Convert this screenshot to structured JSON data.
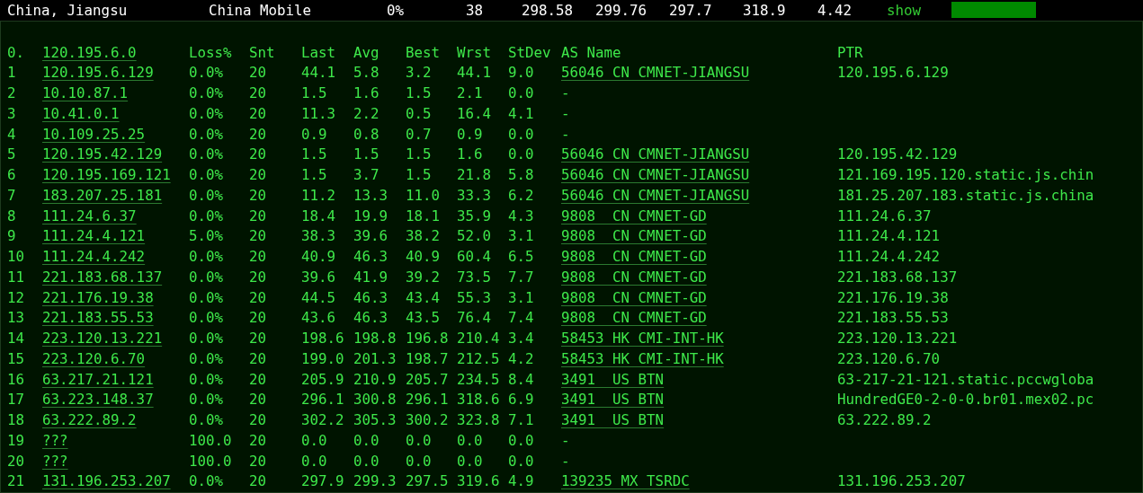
{
  "summary": {
    "location": "China, Jiangsu",
    "carrier": "China Mobile",
    "loss": "0%",
    "sent": "38",
    "last": "298.58",
    "avg": "299.76",
    "best": "297.7",
    "worst": "318.9",
    "stdev": "4.42",
    "toggle": "show"
  },
  "header": {
    "hop": "0.",
    "host": "120.195.6.0",
    "columns": [
      "Loss%",
      "Snt",
      "Last",
      "Avg",
      "Best",
      "Wrst",
      "StDev",
      "AS Name",
      "PTR"
    ]
  },
  "rows": [
    {
      "hop": "1",
      "host": "120.195.6.129",
      "loss": "0.0%",
      "snt": "20",
      "last": "44.1",
      "avg": "5.8",
      "best": "3.2",
      "wrst": "44.1",
      "stdev": "9.0",
      "as_name": "56046 CN CMNET-JIANGSU",
      "as_linked": true,
      "ptr": "120.195.6.129"
    },
    {
      "hop": "2",
      "host": "10.10.87.1",
      "loss": "0.0%",
      "snt": "20",
      "last": "1.5",
      "avg": "1.6",
      "best": "1.5",
      "wrst": "2.1",
      "stdev": "0.0",
      "as_name": "-",
      "as_linked": false
    },
    {
      "hop": "3",
      "host": "10.41.0.1",
      "loss": "0.0%",
      "snt": "20",
      "last": "11.3",
      "avg": "2.2",
      "best": "0.5",
      "wrst": "16.4",
      "stdev": "4.1",
      "as_name": "-",
      "as_linked": false
    },
    {
      "hop": "4",
      "host": "10.109.25.25",
      "loss": "0.0%",
      "snt": "20",
      "last": "0.9",
      "avg": "0.8",
      "best": "0.7",
      "wrst": "0.9",
      "stdev": "0.0",
      "as_name": "-",
      "as_linked": false
    },
    {
      "hop": "5",
      "host": "120.195.42.129",
      "loss": "0.0%",
      "snt": "20",
      "last": "1.5",
      "avg": "1.5",
      "best": "1.5",
      "wrst": "1.6",
      "stdev": "0.0",
      "as_name": "56046 CN CMNET-JIANGSU",
      "as_linked": true,
      "ptr": "120.195.42.129"
    },
    {
      "hop": "6",
      "host": "120.195.169.121",
      "loss": "0.0%",
      "snt": "20",
      "last": "1.5",
      "avg": "3.7",
      "best": "1.5",
      "wrst": "21.8",
      "stdev": "5.8",
      "as_name": "56046 CN CMNET-JIANGSU",
      "as_linked": true,
      "ptr": "121.169.195.120.static.js.chin"
    },
    {
      "hop": "7",
      "host": "183.207.25.181",
      "loss": "0.0%",
      "snt": "20",
      "last": "11.2",
      "avg": "13.3",
      "best": "11.0",
      "wrst": "33.3",
      "stdev": "6.2",
      "as_name": "56046 CN CMNET-JIANGSU",
      "as_linked": true,
      "ptr": "181.25.207.183.static.js.china"
    },
    {
      "hop": "8",
      "host": "111.24.6.37",
      "loss": "0.0%",
      "snt": "20",
      "last": "18.4",
      "avg": "19.9",
      "best": "18.1",
      "wrst": "35.9",
      "stdev": "4.3",
      "as_name": "9808  CN CMNET-GD",
      "as_linked": true,
      "ptr": "111.24.6.37"
    },
    {
      "hop": "9",
      "host": "111.24.4.121",
      "loss": "5.0%",
      "snt": "20",
      "last": "38.3",
      "avg": "39.6",
      "best": "38.2",
      "wrst": "52.0",
      "stdev": "3.1",
      "as_name": "9808  CN CMNET-GD",
      "as_linked": true,
      "ptr": "111.24.4.121"
    },
    {
      "hop": "10",
      "host": "111.24.4.242",
      "loss": "0.0%",
      "snt": "20",
      "last": "40.9",
      "avg": "46.3",
      "best": "40.9",
      "wrst": "60.4",
      "stdev": "6.5",
      "as_name": "9808  CN CMNET-GD",
      "as_linked": true,
      "ptr": "111.24.4.242"
    },
    {
      "hop": "11",
      "host": "221.183.68.137",
      "loss": "0.0%",
      "snt": "20",
      "last": "39.6",
      "avg": "41.9",
      "best": "39.2",
      "wrst": "73.5",
      "stdev": "7.7",
      "as_name": "9808  CN CMNET-GD",
      "as_linked": true,
      "ptr": "221.183.68.137"
    },
    {
      "hop": "12",
      "host": "221.176.19.38",
      "loss": "0.0%",
      "snt": "20",
      "last": "44.5",
      "avg": "46.3",
      "best": "43.4",
      "wrst": "55.3",
      "stdev": "3.1",
      "as_name": "9808  CN CMNET-GD",
      "as_linked": true,
      "ptr": "221.176.19.38"
    },
    {
      "hop": "13",
      "host": "221.183.55.53",
      "loss": "0.0%",
      "snt": "20",
      "last": "43.6",
      "avg": "46.3",
      "best": "43.5",
      "wrst": "76.4",
      "stdev": "7.4",
      "as_name": "9808  CN CMNET-GD",
      "as_linked": true,
      "ptr": "221.183.55.53"
    },
    {
      "hop": "14",
      "host": "223.120.13.221",
      "loss": "0.0%",
      "snt": "20",
      "last": "198.6",
      "avg": "198.8",
      "best": "196.8",
      "wrst": "210.4",
      "stdev": "3.4",
      "as_name": "58453 HK CMI-INT-HK",
      "as_linked": true,
      "ptr": "223.120.13.221"
    },
    {
      "hop": "15",
      "host": "223.120.6.70",
      "loss": "0.0%",
      "snt": "20",
      "last": "199.0",
      "avg": "201.3",
      "best": "198.7",
      "wrst": "212.5",
      "stdev": "4.2",
      "as_name": "58453 HK CMI-INT-HK",
      "as_linked": true,
      "ptr": "223.120.6.70"
    },
    {
      "hop": "16",
      "host": "63.217.21.121",
      "loss": "0.0%",
      "snt": "20",
      "last": "205.9",
      "avg": "210.9",
      "best": "205.7",
      "wrst": "234.5",
      "stdev": "8.4",
      "as_name": "3491  US BTN",
      "as_linked": true,
      "ptr": "63-217-21-121.static.pccwgloba"
    },
    {
      "hop": "17",
      "host": "63.223.148.37",
      "loss": "0.0%",
      "snt": "20",
      "last": "296.1",
      "avg": "300.8",
      "best": "296.1",
      "wrst": "318.6",
      "stdev": "6.9",
      "as_name": "3491  US BTN",
      "as_linked": true,
      "ptr": "HundredGE0-2-0-0.br01.mex02.pc"
    },
    {
      "hop": "18",
      "host": "63.222.89.2",
      "loss": "0.0%",
      "snt": "20",
      "last": "302.2",
      "avg": "305.3",
      "best": "300.2",
      "wrst": "323.8",
      "stdev": "7.1",
      "as_name": "3491  US BTN",
      "as_linked": true,
      "ptr": "63.222.89.2"
    },
    {
      "hop": "19",
      "host": "???",
      "loss": "100.0",
      "snt": "20",
      "last": "0.0",
      "avg": "0.0",
      "best": "0.0",
      "wrst": "0.0",
      "stdev": "0.0",
      "as_name": "-",
      "as_linked": false
    },
    {
      "hop": "20",
      "host": "???",
      "loss": "100.0",
      "snt": "20",
      "last": "0.0",
      "avg": "0.0",
      "best": "0.0",
      "wrst": "0.0",
      "stdev": "0.0",
      "as_name": "-",
      "as_linked": false
    },
    {
      "hop": "21",
      "host": "131.196.253.207",
      "loss": "0.0%",
      "snt": "20",
      "last": "297.9",
      "avg": "299.3",
      "best": "297.5",
      "wrst": "319.6",
      "stdev": "4.9",
      "as_name": "139235 MX TSRDC",
      "as_linked": true,
      "ptr": "131.196.253.207"
    }
  ]
}
